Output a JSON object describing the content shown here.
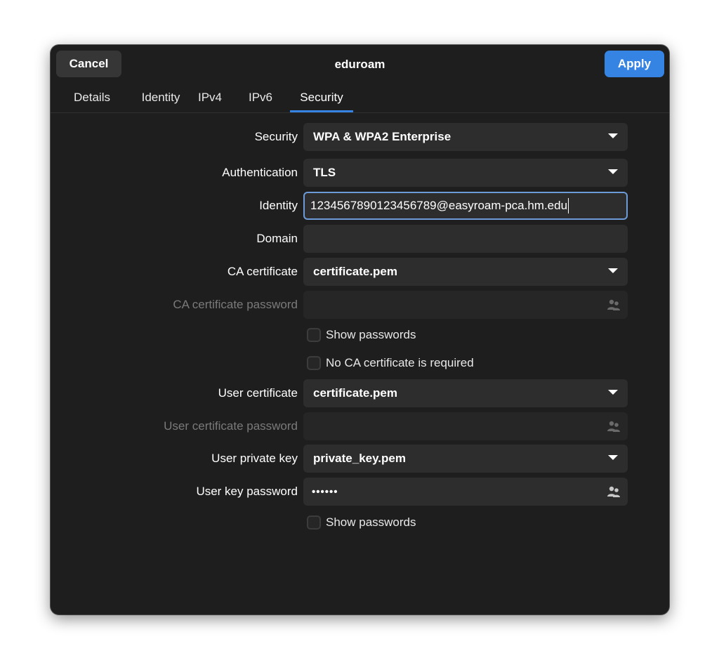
{
  "window": {
    "title": "eduroam",
    "cancel_label": "Cancel",
    "apply_label": "Apply"
  },
  "tabs": [
    {
      "label": "Details"
    },
    {
      "label": "Identity"
    },
    {
      "label": "IPv4"
    },
    {
      "label": "IPv6"
    },
    {
      "label": "Security"
    }
  ],
  "active_tab": "Security",
  "form": {
    "security": {
      "label": "Security",
      "value": "WPA & WPA2 Enterprise"
    },
    "authentication": {
      "label": "Authentication",
      "value": "TLS"
    },
    "identity": {
      "label": "Identity",
      "value": "1234567890123456789@easyroam-pca.hm.edu"
    },
    "domain": {
      "label": "Domain",
      "value": ""
    },
    "ca_certificate": {
      "label": "CA certificate",
      "value": "certificate.pem"
    },
    "ca_certificate_password": {
      "label": "CA certificate password",
      "value": ""
    },
    "show_passwords_1": {
      "label": "Show passwords",
      "checked": false
    },
    "no_ca_required": {
      "label": "No CA certificate is required",
      "checked": false
    },
    "user_certificate": {
      "label": "User certificate",
      "value": "certificate.pem"
    },
    "user_certificate_password": {
      "label": "User certificate password",
      "value": ""
    },
    "user_private_key": {
      "label": "User private key",
      "value": "private_key.pem"
    },
    "user_key_password": {
      "label": "User key password",
      "value": "••••••"
    },
    "show_passwords_2": {
      "label": "Show passwords",
      "checked": false
    }
  },
  "colors": {
    "accent": "#3584e4",
    "window_bg": "#1e1e1e",
    "field_bg": "#2d2d2d"
  },
  "icons": {
    "combo_arrow": "pan-down-icon",
    "password_storage": "people-icon"
  }
}
